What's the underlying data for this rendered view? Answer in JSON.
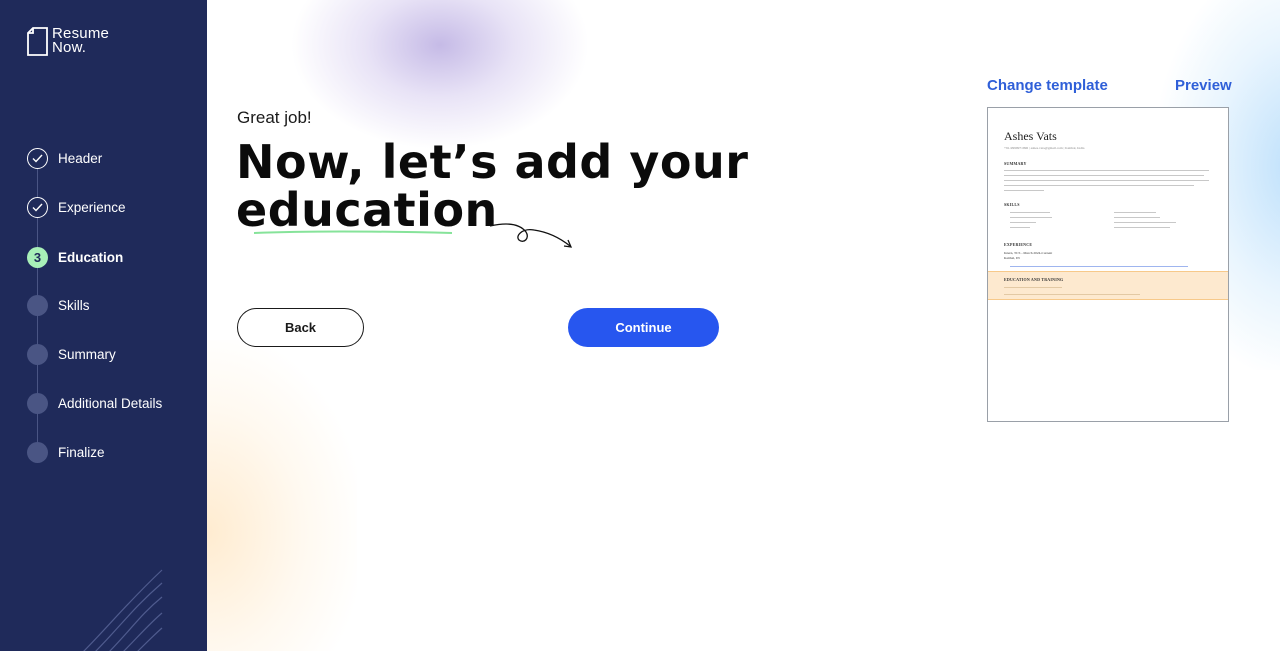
{
  "brand": {
    "logo_line1": "Resume",
    "logo_line2": "Now."
  },
  "steps": [
    {
      "label": "Header",
      "state": "done"
    },
    {
      "label": "Experience",
      "state": "done"
    },
    {
      "label": "Education",
      "state": "current",
      "number": "3"
    },
    {
      "label": "Skills",
      "state": "pending"
    },
    {
      "label": "Summary",
      "state": "pending"
    },
    {
      "label": "Additional Details",
      "state": "pending"
    },
    {
      "label": "Finalize",
      "state": "pending"
    }
  ],
  "main": {
    "subtitle": "Great job!",
    "headline_line1": "Now, let’s add your",
    "headline_line2": "education",
    "back_label": "Back",
    "continue_label": "Continue"
  },
  "right": {
    "change_template": "Change template",
    "preview": "Preview"
  },
  "resume_preview": {
    "name": "Ashes Vats",
    "contact": "+91-9999971996 | ashes.vats@gmail.com | Kaithal, India",
    "section_summary": "SUMMARY",
    "section_skills": "SKILLS",
    "section_experience": "EXPERIENCE",
    "experience_title": "Intern, TCS - March 2024-Current",
    "experience_location": "Kaithal, IN",
    "section_education": "EDUCATION AND TRAINING"
  },
  "colors": {
    "sidebar": "#1f2a5a",
    "accent": "#2756ef",
    "link": "#2f5fd8",
    "step_current": "#a8f0b8"
  }
}
